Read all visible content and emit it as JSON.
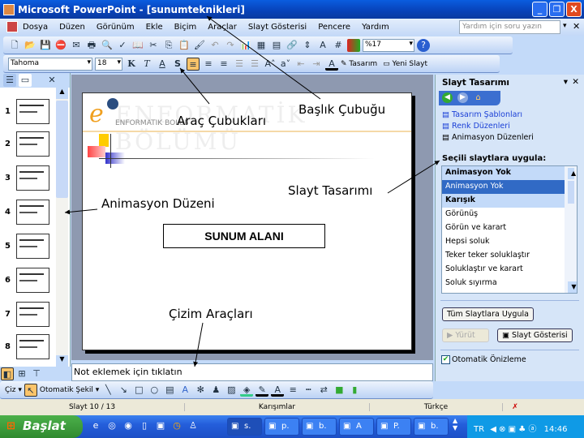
{
  "window": {
    "title": "Microsoft PowerPoint - [sunumteknikleri]",
    "min": "_",
    "max": "❐",
    "close": "X"
  },
  "menu": [
    "Dosya",
    "Düzen",
    "Görünüm",
    "Ekle",
    "Biçim",
    "Araçlar",
    "Slayt Gösterisi",
    "Pencere",
    "Yardım"
  ],
  "help_placeholder": "Yardım için soru yazın",
  "toolbar": {
    "zoom": "%17",
    "font": "Tahoma",
    "size": "18",
    "bold": "K",
    "italic": "T",
    "underline": "A",
    "shadow": "S",
    "design": "Tasarım",
    "new_slide": "Yeni Slayt"
  },
  "thumbs": [
    "1",
    "2",
    "3",
    "4",
    "5",
    "6",
    "7",
    "8"
  ],
  "slide": {
    "watermark": "ENFORMATİK BÖLÜMÜ",
    "logo": "ENFORMATİK BÖLÜMÜ",
    "center": "SUNUM ALANI"
  },
  "annotations": {
    "toolbars": "Araç Çubukları",
    "titlebar": "Başlık Çubuğu",
    "animation": "Animasyon Düzeni",
    "design": "Slayt Tasarımı",
    "drawing": "Çizim Araçları"
  },
  "notes_placeholder": "Not eklemek için tıklatın",
  "taskpane": {
    "title": "Slayt Tasarımı",
    "links": [
      "Tasarım Şablonları",
      "Renk Düzenleri",
      "Animasyon Düzenleri"
    ],
    "apply_label": "Seçili slaytlara uygula:",
    "list": [
      {
        "t": "Animasyon Yok",
        "k": "header"
      },
      {
        "t": "Animasyon Yok",
        "k": "selected"
      },
      {
        "t": "Karışık",
        "k": "header"
      },
      {
        "t": "Görünüş"
      },
      {
        "t": "Görün ve karart"
      },
      {
        "t": "Hepsi soluk"
      },
      {
        "t": "Teker teker soluklaştır"
      },
      {
        "t": "Soluklaştır ve karart"
      },
      {
        "t": "Soluk sıyırma"
      }
    ],
    "apply_all": "Tüm Slaytlara Uygula",
    "play": "Yürüt",
    "slideshow": "Slayt Gösterisi",
    "autopreview": "Otomatik Önizleme",
    "autopreview_checked": true
  },
  "draw": {
    "draw": "Çiz",
    "autoshapes": "Otomatik Şekil"
  },
  "status": {
    "slide": "Slayt 10 / 13",
    "design": "Karışımlar",
    "lang": "Türkçe"
  },
  "taskbar": {
    "start": "Başlat",
    "tasks": [
      "s.",
      "p.",
      "b.",
      "A",
      "P.",
      "b."
    ],
    "lang": "TR",
    "clock": "14:46"
  }
}
